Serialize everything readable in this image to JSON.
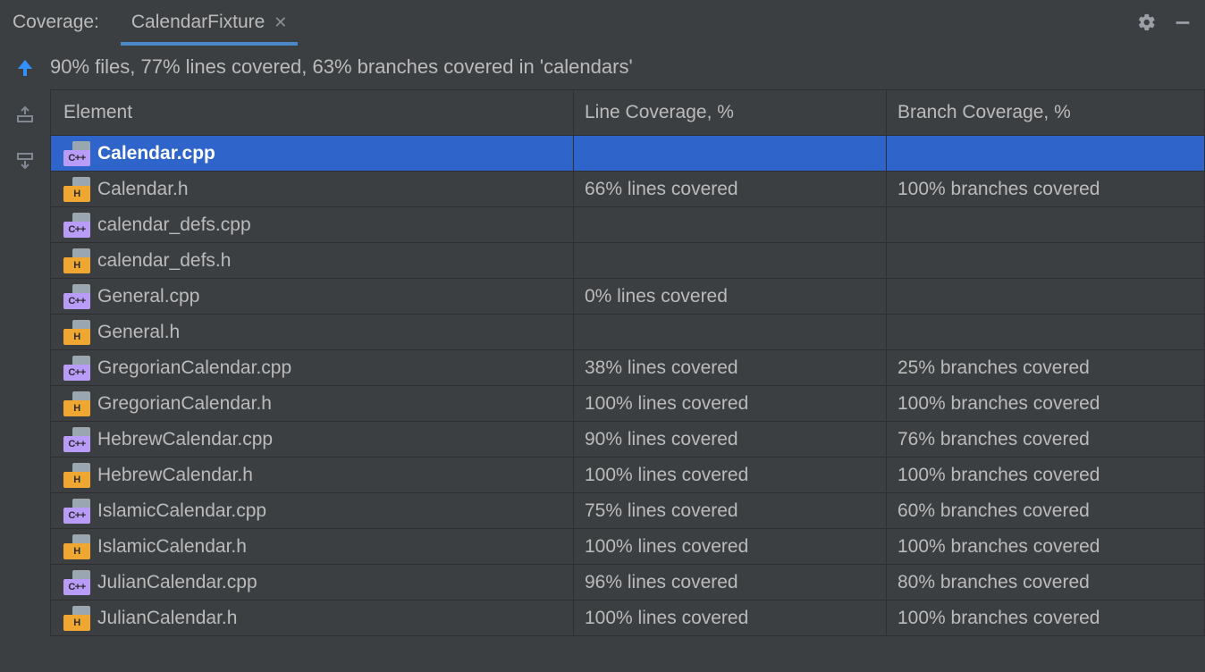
{
  "header": {
    "title": "Coverage:",
    "tab_label": "CalendarFixture"
  },
  "summary": "90% files, 77% lines covered, 63% branches covered in 'calendars'",
  "columns": {
    "element": "Element",
    "line": "Line Coverage, %",
    "branch": "Branch Coverage, %"
  },
  "rows": [
    {
      "name": "Calendar.cpp",
      "type": "cpp",
      "line": "",
      "branch": "",
      "selected": true
    },
    {
      "name": "Calendar.h",
      "type": "h",
      "line": "66% lines covered",
      "branch": "100% branches covered"
    },
    {
      "name": "calendar_defs.cpp",
      "type": "cpp",
      "line": "",
      "branch": ""
    },
    {
      "name": "calendar_defs.h",
      "type": "h",
      "line": "",
      "branch": ""
    },
    {
      "name": "General.cpp",
      "type": "cpp",
      "line": "0% lines covered",
      "branch": ""
    },
    {
      "name": "General.h",
      "type": "h",
      "line": "",
      "branch": ""
    },
    {
      "name": "GregorianCalendar.cpp",
      "type": "cpp",
      "line": "38% lines covered",
      "branch": "25% branches covered"
    },
    {
      "name": "GregorianCalendar.h",
      "type": "h",
      "line": "100% lines covered",
      "branch": "100% branches covered"
    },
    {
      "name": "HebrewCalendar.cpp",
      "type": "cpp",
      "line": "90% lines covered",
      "branch": "76% branches covered"
    },
    {
      "name": "HebrewCalendar.h",
      "type": "h",
      "line": "100% lines covered",
      "branch": "100% branches covered"
    },
    {
      "name": "IslamicCalendar.cpp",
      "type": "cpp",
      "line": "75% lines covered",
      "branch": "60% branches covered"
    },
    {
      "name": "IslamicCalendar.h",
      "type": "h",
      "line": "100% lines covered",
      "branch": "100% branches covered"
    },
    {
      "name": "JulianCalendar.cpp",
      "type": "cpp",
      "line": "96% lines covered",
      "branch": "80% branches covered"
    },
    {
      "name": "JulianCalendar.h",
      "type": "h",
      "line": "100% lines covered",
      "branch": "100% branches covered"
    }
  ],
  "icon_labels": {
    "cpp": "C++",
    "h": "H"
  }
}
